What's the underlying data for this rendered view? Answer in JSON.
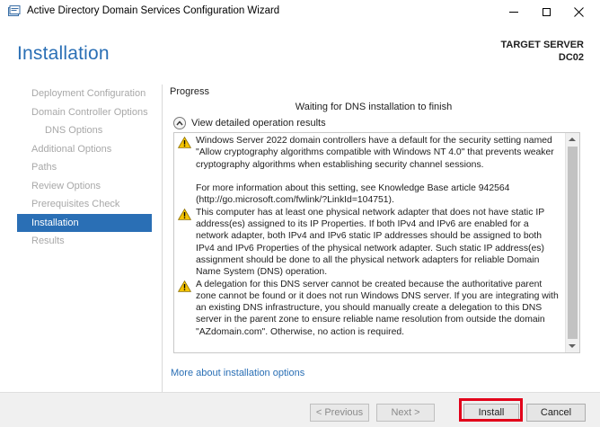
{
  "window": {
    "title": "Active Directory Domain Services Configuration Wizard",
    "icon": "ad-wizard-icon"
  },
  "header": {
    "page_title": "Installation",
    "target_label": "TARGET SERVER",
    "target_name": "DC02"
  },
  "sidebar": {
    "items": [
      {
        "label": "Deployment Configuration",
        "state": "disabled"
      },
      {
        "label": "Domain Controller Options",
        "state": "disabled"
      },
      {
        "label": "DNS Options",
        "state": "disabled"
      },
      {
        "label": "Additional Options",
        "state": "disabled"
      },
      {
        "label": "Paths",
        "state": "disabled"
      },
      {
        "label": "Review Options",
        "state": "disabled"
      },
      {
        "label": "Prerequisites Check",
        "state": "disabled"
      },
      {
        "label": "Installation",
        "state": "active"
      },
      {
        "label": "Results",
        "state": "disabled"
      }
    ]
  },
  "main": {
    "progress_label": "Progress",
    "status_text": "Waiting for DNS installation to finish",
    "details_toggle_label": "View detailed operation results",
    "results": [
      {
        "icon": "warning-icon",
        "paragraphs": [
          "Windows Server 2022 domain controllers have a default for the security setting named \"Allow cryptography algorithms compatible with Windows NT 4.0\" that prevents weaker cryptography algorithms when establishing security channel sessions.",
          "For more information about this setting, see Knowledge Base article 942564 (http://go.microsoft.com/fwlink/?LinkId=104751)."
        ]
      },
      {
        "icon": "warning-icon",
        "paragraphs": [
          "This computer has at least one physical network adapter that does not have static IP address(es) assigned to its IP Properties. If both IPv4 and IPv6 are enabled for a network adapter, both IPv4 and IPv6 static IP addresses should be assigned to both IPv4 and IPv6 Properties of the physical network adapter. Such static IP address(es) assignment should be done to all the physical network adapters for reliable Domain Name System (DNS) operation."
        ]
      },
      {
        "icon": "warning-icon",
        "paragraphs": [
          "A delegation for this DNS server cannot be created because the authoritative parent zone cannot be found or it does not run Windows DNS server. If you are integrating with an existing DNS infrastructure, you should manually create a delegation to this DNS server in the parent zone to ensure reliable name resolution from outside the domain \"AZdomain.com\". Otherwise, no action is required."
        ]
      }
    ],
    "more_link": "More about installation options"
  },
  "footer": {
    "previous_label": "< Previous",
    "next_label": "Next >",
    "install_label": "Install",
    "cancel_label": "Cancel"
  },
  "colors": {
    "accent": "#2a6fb5",
    "highlight": "#e2001a",
    "warning": "#f5c400"
  }
}
